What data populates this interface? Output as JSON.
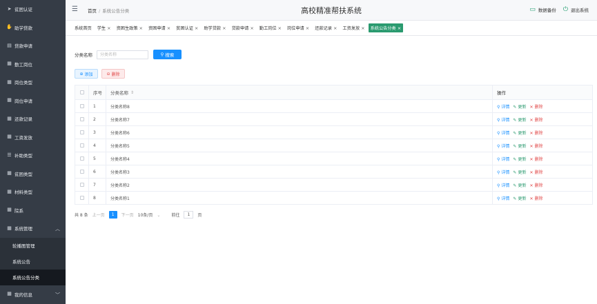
{
  "sidebar": {
    "items": [
      {
        "label": "贫困认证",
        "icon": "send-icon",
        "glyph": "➤"
      },
      {
        "label": "助学贷款",
        "icon": "hand-money-icon",
        "glyph": "✋"
      },
      {
        "label": "贷款申请",
        "icon": "document-icon",
        "glyph": "▤"
      },
      {
        "label": "勤工岗位",
        "icon": "grid-icon",
        "glyph": "▦"
      },
      {
        "label": "岗位类型",
        "icon": "grid-icon",
        "glyph": "▦"
      },
      {
        "label": "岗位申请",
        "icon": "grid-icon",
        "glyph": "▦"
      },
      {
        "label": "还款记录",
        "icon": "grid-icon",
        "glyph": "▦"
      },
      {
        "label": "工资发放",
        "icon": "grid-icon",
        "glyph": "▦"
      },
      {
        "label": "补助类型",
        "icon": "sliders-icon",
        "glyph": "☰"
      },
      {
        "label": "贫困类型",
        "icon": "grid-icon",
        "glyph": "▦"
      },
      {
        "label": "材料类型",
        "icon": "grid-icon",
        "glyph": "▦"
      },
      {
        "label": "院系",
        "icon": "grid-icon",
        "glyph": "▦"
      },
      {
        "label": "系统管理",
        "icon": "grid-icon",
        "glyph": "▦"
      }
    ],
    "system_arrow": "︿",
    "sub_items": [
      {
        "label": "轮播图管理"
      },
      {
        "label": "系统公告"
      },
      {
        "label": "系统公告分类"
      }
    ],
    "bottom": {
      "label": "我的信息",
      "icon": "grid-icon",
      "glyph": "▦",
      "arrow": "﹀"
    }
  },
  "header": {
    "menu_glyph": "☰",
    "breadcrumb_home": "首页",
    "breadcrumb_sep": "/",
    "breadcrumb_current": "系统公告分类",
    "title": "高校精准帮扶系统",
    "backup_label": "数据备份",
    "logout_label": "退出系统",
    "backup_glyph": "▭",
    "logout_glyph": "⏻"
  },
  "tabs": [
    {
      "label": "系统首页",
      "closable": false
    },
    {
      "label": "学生",
      "closable": true
    },
    {
      "label": "资困生政策",
      "closable": true
    },
    {
      "label": "资困申请",
      "closable": true
    },
    {
      "label": "贫困认证",
      "closable": true
    },
    {
      "label": "助学贷款",
      "closable": true
    },
    {
      "label": "贷款申请",
      "closable": true
    },
    {
      "label": "勤工岗位",
      "closable": true
    },
    {
      "label": "岗位申请",
      "closable": true
    },
    {
      "label": "还款记录",
      "closable": true
    },
    {
      "label": "工资发放",
      "closable": true
    },
    {
      "label": "系统公告分类",
      "closable": true,
      "active": true
    }
  ],
  "tab_close_glyph": "×",
  "search": {
    "label": "分类名称",
    "placeholder": "分类名称",
    "button_label": "搜索",
    "button_glyph": "⚲"
  },
  "actions": {
    "add_label": "添加",
    "add_glyph": "⊕",
    "delete_label": "删除",
    "delete_glyph": "⊖"
  },
  "table": {
    "headers": {
      "index": "序号",
      "name": "分类名称",
      "sort": "⇕",
      "ops": "操作"
    },
    "rows": [
      {
        "index": "1",
        "name": "分类名称8"
      },
      {
        "index": "2",
        "name": "分类名称7"
      },
      {
        "index": "3",
        "name": "分类名称6"
      },
      {
        "index": "4",
        "name": "分类名称5"
      },
      {
        "index": "5",
        "name": "分类名称4"
      },
      {
        "index": "6",
        "name": "分类名称3"
      },
      {
        "index": "7",
        "name": "分类名称2"
      },
      {
        "index": "8",
        "name": "分类名称1"
      }
    ],
    "ops": {
      "detail": "详情",
      "detail_glyph": "⚲",
      "edit": "更新",
      "edit_glyph": "✎",
      "delete": "删除",
      "delete_glyph": "✕"
    }
  },
  "pager": {
    "total": "共 8 条",
    "prev": "上一页",
    "current": "1",
    "next": "下一页",
    "size": "10条/页",
    "size_caret": "⌄",
    "jump_label": "前往",
    "jump_value": "1",
    "jump_unit": "页"
  },
  "colors": {
    "sidebar_bg": "#353c46",
    "accent_green": "#2a9a6f",
    "primary_blue": "#1890ff",
    "danger_red": "#e14b4b"
  }
}
